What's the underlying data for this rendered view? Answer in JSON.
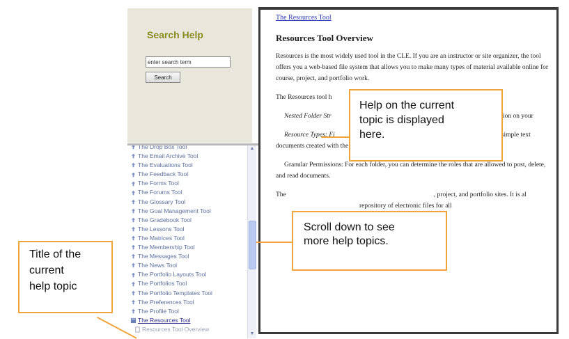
{
  "search": {
    "title": "Search Help",
    "input_value": "enter search term",
    "button_label": "Search"
  },
  "nav": {
    "items": [
      "The Drop Box Tool",
      "The Email Archive Tool",
      "The Evaluations Tool",
      "The Feedback Tool",
      "The Forms Tool",
      "The Forums Tool",
      "The Glossary Tool",
      "The Goal Management Tool",
      "The Gradebook Tool",
      "The Lessons Tool",
      "The Matrices Tool",
      "The Membership Tool",
      "The Messages Tool",
      "The News Tool",
      "The Portfolio Layouts Tool",
      "The Portfolios Tool",
      "The Portfolio Templates Tool",
      "The Preferences Tool",
      "The Profile Tool",
      "The Resources Tool",
      "Resources Tool Overview"
    ],
    "current_index": 19
  },
  "content": {
    "breadcrumb": "The Resources Tool",
    "title": "Resources Tool Overview",
    "paragraphs": [
      "Resources is the most widely used tool in the CLE. If you are an instructor or site organizer, the tool offers you a web-based file system that allows you to make many types of material available online for course, project, and portfolio work.",
      "The Resources tool h",
      "Nested Folder Str",
      "ents and information on your",
      "Resource Types: Fi",
      ", URL links, simple text documents created with the built-in text editor, and HTML documents",
      "Granular Permissions: For each folder, you can determine the roles that are allowed to post, delete, and read documents.",
      "The",
      ", project, and portfolio sites. It is al",
      "repository of electronic files for all"
    ]
  },
  "callouts": {
    "help_lines": [
      "Help on the current",
      "topic is displayed",
      "here."
    ],
    "scroll_lines": [
      "Scroll down to see",
      "more help topics."
    ],
    "title_lines": [
      "Title of the",
      "current",
      "help topic"
    ]
  },
  "colors": {
    "callout_border": "#f0a43a",
    "search_title": "#8a8b1e",
    "link": "#2b3bb5",
    "nav_text": "#5a6f9e"
  }
}
